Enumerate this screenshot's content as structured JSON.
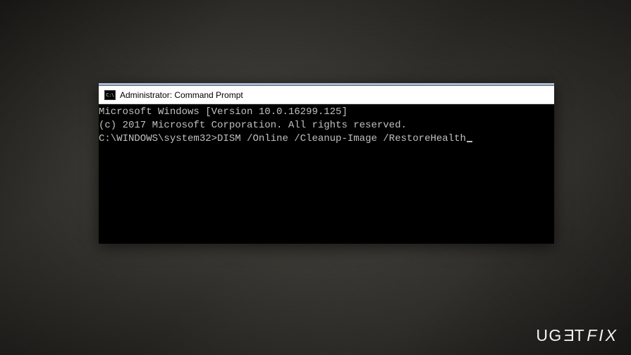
{
  "window": {
    "icon_label": "C:\\",
    "title": "Administrator: Command Prompt"
  },
  "console": {
    "line1": "Microsoft Windows [Version 10.0.16299.125]",
    "line2": "(c) 2017 Microsoft Corporation. All rights reserved.",
    "blank": "",
    "prompt": "C:\\WINDOWS\\system32>",
    "command": "DISM /Online /Cleanup-Image /RestoreHealth"
  },
  "watermark": {
    "pre": "UG",
    "e": "E",
    "t": "T",
    "fix": "FIX"
  }
}
